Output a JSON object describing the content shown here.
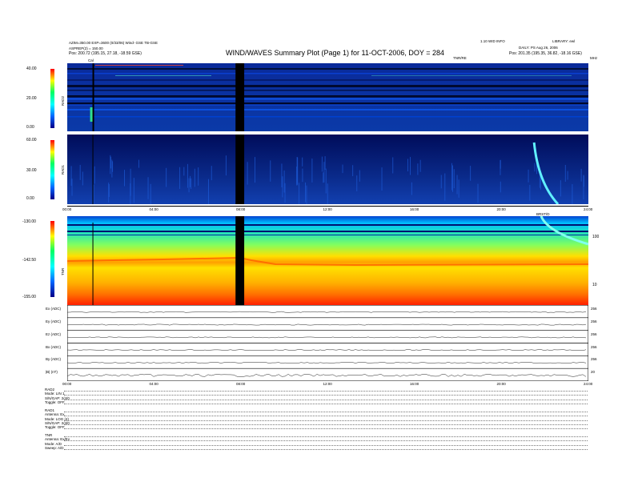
{
  "header": {
    "left_line1": "AZIM=350.00 EXP=3600 (0/33/06) Wind- GSE TB-GSE",
    "left_line2": "ASPREP(2) = 150.00",
    "left_line3": "Pos: 200.72 (195.15, 27.18, -18.59 GSE)",
    "title": "WIND/WAVES Summary Plot (Page 1) for 11-OCT-2006, DOY = 284",
    "right_line1": "1.10 WID INFO",
    "right_line2": "LIBRARY: ewl",
    "right_line3": "DAILY: PS Aug 26, 2006",
    "right_line4": "Pos: 201.35 (195.35, 36.82, -18.16 GSE)",
    "tnr_label": "TNR/RE",
    "cal_label": "Cal",
    "right_corner": "MHz"
  },
  "panels": {
    "rad2": {
      "name": "RAD2",
      "ticks": [
        "40.00",
        "20.00",
        "0.00"
      ]
    },
    "rad1": {
      "name": "RAD1",
      "ticks": [
        "60.00",
        "30.00",
        "0.00"
      ]
    },
    "tnr": {
      "name": "TNR",
      "ticks": [
        "-130.00",
        "-142.50",
        "-155.00"
      ],
      "right_ticks": [
        "100",
        "10"
      ]
    },
    "burst_label": "BRST/D"
  },
  "time_ticks": [
    "00:00",
    "04:00",
    "08:00",
    "12:00",
    "16:00",
    "20:00",
    "24:00"
  ],
  "line_panels": {
    "rows": [
      {
        "label": "Ex (ADC)",
        "right": "256"
      },
      {
        "label": "Ey (ADC)",
        "right": "256"
      },
      {
        "label": "Ez (ADC)",
        "right": "256"
      },
      {
        "label": "Bx (ADC)",
        "right": "256"
      },
      {
        "label": "By (ADC)",
        "right": "256"
      },
      {
        "label": "|B| (nT)",
        "right": "20"
      }
    ],
    "bottom_ticks": [
      "00:00",
      "04:00",
      "08:00",
      "12:00",
      "16:00",
      "20:00",
      "24:00"
    ]
  },
  "footer": {
    "block1": [
      "RAD2",
      "Mode:  LIN 1",
      "S/N/GAP: 2/4/0",
      "Toggle:  OFF"
    ],
    "block2": [
      "RAD1",
      "Antenna:  Ex",
      "Mode:  LOG (4)",
      "S/N/GAP: 2/4/0",
      "Toggle:  OFF"
    ],
    "block3": [
      "TNR",
      "Antenna:  Ex/Ey",
      "Mode:  A/D",
      "Sweep:  A/D"
    ]
  },
  "chart_data": [
    {
      "type": "heatmap",
      "title": "WIND/WAVES Summary Plot (Page 1) for 11-OCT-2006, DOY = 284",
      "xlabel": "",
      "ylabel": "RAD2",
      "x_range_hours": [
        0,
        24
      ],
      "colorbar_range": [
        0,
        40
      ],
      "data_gap_hours": [
        7.75,
        8.15
      ],
      "calibration_hour": 1.2,
      "grid": false
    },
    {
      "type": "heatmap",
      "ylabel": "RAD1",
      "x_range_hours": [
        0,
        24
      ],
      "colorbar_range": [
        0,
        60
      ],
      "data_gap_hours": [
        7.75,
        8.15
      ],
      "burst_hours": [
        21.5,
        22.6
      ],
      "grid": false
    },
    {
      "type": "heatmap",
      "ylabel": "TNR",
      "x_range_hours": [
        0,
        24
      ],
      "colorbar_range": [
        -155,
        -130
      ],
      "data_gap_hours": [
        7.75,
        8.15
      ],
      "grid": false
    },
    {
      "type": "line",
      "x_range_hours": [
        0,
        24
      ],
      "series": [
        {
          "name": "Ex (ADC)"
        },
        {
          "name": "Ey (ADC)"
        },
        {
          "name": "Ez (ADC)"
        },
        {
          "name": "Bx (ADC)"
        },
        {
          "name": "By (ADC)"
        },
        {
          "name": "|B| (nT)"
        }
      ]
    }
  ]
}
